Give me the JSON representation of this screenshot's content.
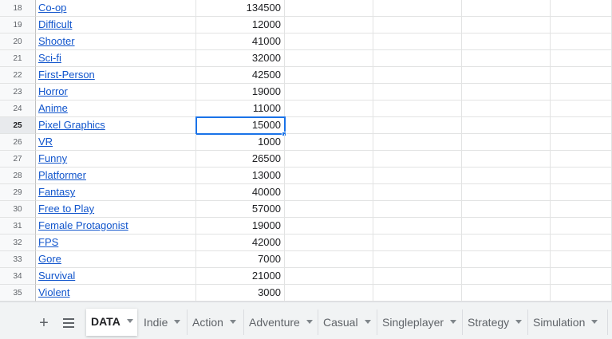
{
  "rows": [
    {
      "num": "18",
      "tag": "Co-op",
      "value": "134500"
    },
    {
      "num": "19",
      "tag": "Difficult",
      "value": "12000"
    },
    {
      "num": "20",
      "tag": "Shooter",
      "value": "41000"
    },
    {
      "num": "21",
      "tag": "Sci-fi",
      "value": "32000"
    },
    {
      "num": "22",
      "tag": "First-Person",
      "value": "42500"
    },
    {
      "num": "23",
      "tag": "Horror",
      "value": "19000"
    },
    {
      "num": "24",
      "tag": "Anime",
      "value": "11000"
    },
    {
      "num": "25",
      "tag": "Pixel Graphics",
      "value": "15000"
    },
    {
      "num": "26",
      "tag": "VR",
      "value": "1000"
    },
    {
      "num": "27",
      "tag": "Funny",
      "value": "26500"
    },
    {
      "num": "28",
      "tag": "Platformer",
      "value": "13000"
    },
    {
      "num": "29",
      "tag": "Fantasy",
      "value": "40000"
    },
    {
      "num": "30",
      "tag": "Free to Play",
      "value": "57000"
    },
    {
      "num": "31",
      "tag": "Female Protagonist",
      "value": "19000"
    },
    {
      "num": "32",
      "tag": "FPS",
      "value": "42000"
    },
    {
      "num": "33",
      "tag": "Gore",
      "value": "7000"
    },
    {
      "num": "34",
      "tag": "Survival",
      "value": "21000"
    },
    {
      "num": "35",
      "tag": "Violent",
      "value": "3000"
    }
  ],
  "selected_row": "25",
  "sheet_tabs": {
    "add_icon": "plus-icon",
    "list_icon": "menu-lines-icon",
    "tabs": [
      "DATA",
      "Indie",
      "Action",
      "Adventure",
      "Casual",
      "Singleplayer",
      "Strategy",
      "Simulation"
    ],
    "active": "DATA"
  },
  "colors": {
    "link": "#1155cc",
    "selection": "#1a73e8",
    "tabbar_bg": "#f1f3f4"
  }
}
